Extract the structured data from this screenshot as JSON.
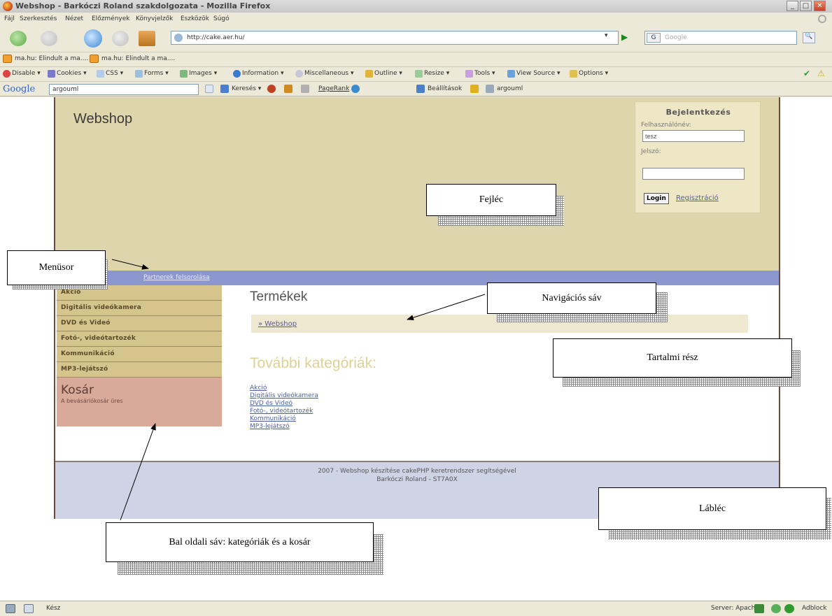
{
  "window": {
    "title": "Webshop - Barkóczi Roland szakdolgozata - Mozilla Firefox",
    "buttons": {
      "minimize": "_",
      "maximize": "□",
      "close": "✕"
    }
  },
  "menubar": [
    "Fájl",
    "Szerkesztés",
    "Nézet",
    "Előzmények",
    "Könyvjelzők",
    "Eszközök",
    "Súgó"
  ],
  "navbar": {
    "url": "http://cake.aer.hu/",
    "search_placeholder": "Google",
    "search_engine": "G",
    "go_symbol": "▶",
    "dropdown_symbol": "▾",
    "search_button": "🔍"
  },
  "bookmarks": [
    "ma.hu: Elindult a ma....",
    "ma.hu: Elindult a ma...."
  ],
  "devbar": [
    "Disable ▾",
    "Cookies ▾",
    "CSS ▾",
    "Forms ▾",
    "Images ▾",
    "Information ▾",
    "Miscellaneous ▾",
    "Outline ▾",
    "Resize ▾",
    "Tools ▾",
    "View Source ▾",
    "Options ▾"
  ],
  "gbar": {
    "logo": "Google",
    "input": "argouml",
    "items": [
      "Keresés ▾",
      "PageRank",
      "Beállítások",
      "argouml"
    ]
  },
  "page": {
    "site_title": "Webshop",
    "login": {
      "title": "Bejelentkezés",
      "user_label": "Felhasználónév:",
      "user_value": "tesz",
      "pass_label": "Jelszó:",
      "button": "Login",
      "register": "Regisztráció"
    },
    "menu": {
      "link": "Partnerek felsorolása"
    },
    "categories": [
      "Akció",
      "Digitális videókamera",
      "DVD és Videó",
      "Fotó-, videótartozék",
      "Kommunikáció",
      "MP3-lejátszó"
    ],
    "cart": {
      "title": "Kosár",
      "subtitle": "A bevásárlókosár üres"
    },
    "content": {
      "heading": "Termékek",
      "breadcrumb": "» Webshop",
      "subheading": "További kategóriák:",
      "links": [
        "Akció",
        "Digitális videókamera",
        "DVD és Videó",
        "Fotó-, videótartozék",
        "Kommunikáció",
        "MP3-lejátszó"
      ]
    },
    "footer": {
      "line1": "2007 - Webshop készítése cakePHP keretrendszer segítségével",
      "line2": "Barkóczi Roland - ST7A0X"
    }
  },
  "callouts": {
    "header": "Fejléc",
    "menu": "Menüsor",
    "nav": "Navigációs sáv",
    "content": "Tartalmi rész",
    "footer": "Lábléc",
    "sidebar": "Bal oldali sáv: kategóriák és a kosár"
  },
  "statusbar": {
    "left": "Kész",
    "server": "Server: Apache",
    "adblock": "Adblock"
  }
}
